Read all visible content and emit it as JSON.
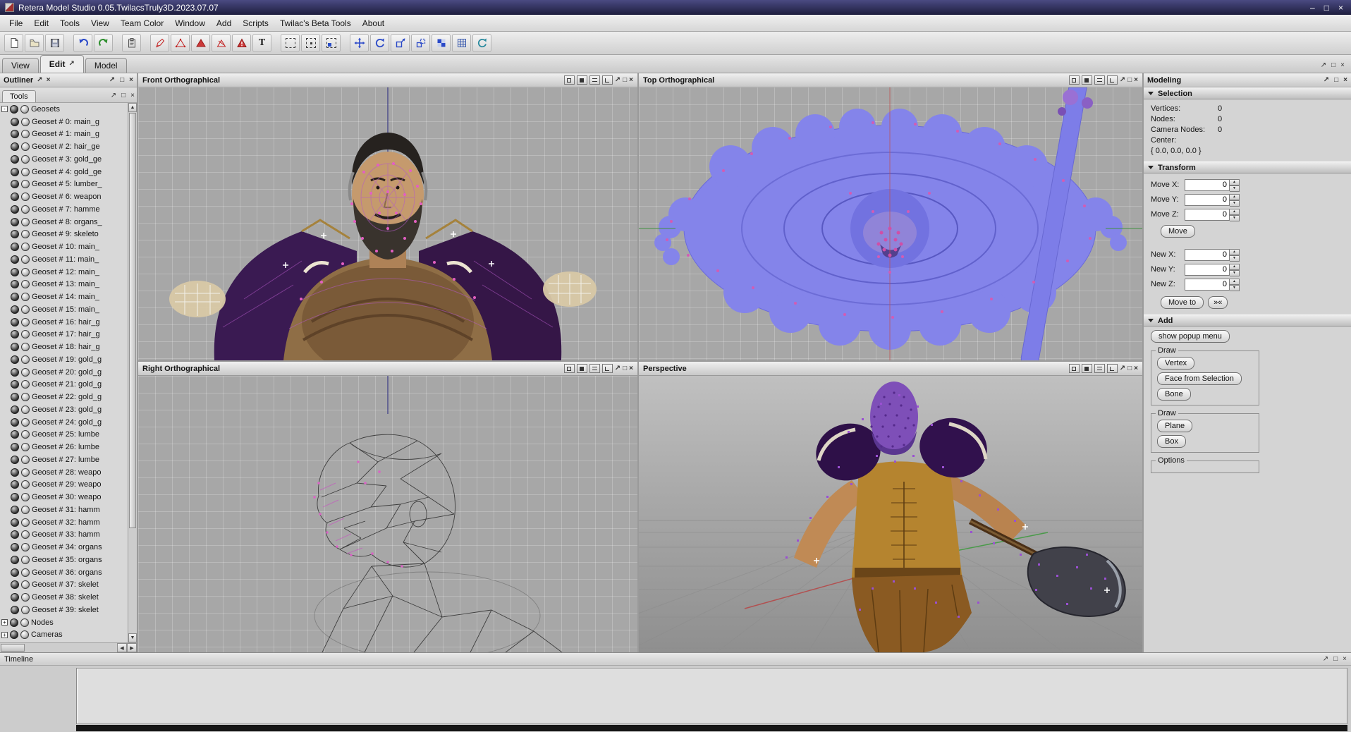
{
  "window": {
    "title": "Retera Model Studio 0.05.TwilacsTruly3D.2023.07.07",
    "minimize": "–",
    "maximize": "□",
    "close": "×"
  },
  "chrome": {
    "float": "↗",
    "maximize": "□",
    "close": "×",
    "spin_up": "▲",
    "spin_down": "▼",
    "arrow_up": "▲",
    "arrow_down": "▼",
    "arrow_left": "◀",
    "arrow_right": "▶"
  },
  "menubar": {
    "items": [
      "File",
      "Edit",
      "Tools",
      "View",
      "Team Color",
      "Window",
      "Add",
      "Scripts",
      "Twilac's Beta Tools",
      "About"
    ]
  },
  "toolbar": {
    "text_glyph": "T",
    "icons": [
      "new-document",
      "open-model",
      "save",
      "undo",
      "redo",
      "paste",
      "edit-pen",
      "face-outline",
      "face-solid",
      "rig-pen",
      "face-alert",
      "text-tool",
      "select-marquee",
      "select-add",
      "select-paint",
      "move-tool",
      "rotate-tool",
      "scale-tool",
      "extrude-tool",
      "snap-checker",
      "snap-grid",
      "recalculate-normals"
    ]
  },
  "tabs": {
    "items": [
      {
        "label": "View"
      },
      {
        "label": "Edit"
      },
      {
        "label": "Model"
      }
    ],
    "active": "Edit"
  },
  "outliner": {
    "title": "Outliner",
    "tools_tab": "Tools",
    "items": [
      {
        "label": "Geosets",
        "exp": "-",
        "cls": "root"
      },
      {
        "label": "Geoset # 0: main_g",
        "exp": "",
        "cls": "child"
      },
      {
        "label": "Geoset # 1: main_g",
        "exp": "",
        "cls": "child"
      },
      {
        "label": "Geoset # 2: hair_ge",
        "exp": "",
        "cls": "child"
      },
      {
        "label": "Geoset # 3: gold_ge",
        "exp": "",
        "cls": "child"
      },
      {
        "label": "Geoset # 4: gold_ge",
        "exp": "",
        "cls": "child"
      },
      {
        "label": "Geoset # 5: lumber_",
        "exp": "",
        "cls": "child"
      },
      {
        "label": "Geoset # 6: weapon",
        "exp": "",
        "cls": "child"
      },
      {
        "label": "Geoset # 7: hamme",
        "exp": "",
        "cls": "child"
      },
      {
        "label": "Geoset # 8: organs_",
        "exp": "",
        "cls": "child"
      },
      {
        "label": "Geoset # 9: skeleto",
        "exp": "",
        "cls": "child"
      },
      {
        "label": "Geoset # 10: main_",
        "exp": "",
        "cls": "child"
      },
      {
        "label": "Geoset # 11: main_",
        "exp": "",
        "cls": "child"
      },
      {
        "label": "Geoset # 12: main_",
        "exp": "",
        "cls": "child"
      },
      {
        "label": "Geoset # 13: main_",
        "exp": "",
        "cls": "child"
      },
      {
        "label": "Geoset # 14: main_",
        "exp": "",
        "cls": "child"
      },
      {
        "label": "Geoset # 15: main_",
        "exp": "",
        "cls": "child"
      },
      {
        "label": "Geoset # 16: hair_g",
        "exp": "",
        "cls": "child"
      },
      {
        "label": "Geoset # 17: hair_g",
        "exp": "",
        "cls": "child"
      },
      {
        "label": "Geoset # 18: hair_g",
        "exp": "",
        "cls": "child"
      },
      {
        "label": "Geoset # 19: gold_g",
        "exp": "",
        "cls": "child"
      },
      {
        "label": "Geoset # 20: gold_g",
        "exp": "",
        "cls": "child"
      },
      {
        "label": "Geoset # 21: gold_g",
        "exp": "",
        "cls": "child"
      },
      {
        "label": "Geoset # 22: gold_g",
        "exp": "",
        "cls": "child"
      },
      {
        "label": "Geoset # 23: gold_g",
        "exp": "",
        "cls": "child"
      },
      {
        "label": "Geoset # 24: gold_g",
        "exp": "",
        "cls": "child"
      },
      {
        "label": "Geoset # 25: lumbe",
        "exp": "",
        "cls": "child"
      },
      {
        "label": "Geoset # 26: lumbe",
        "exp": "",
        "cls": "child"
      },
      {
        "label": "Geoset # 27: lumbe",
        "exp": "",
        "cls": "child"
      },
      {
        "label": "Geoset # 28: weapo",
        "exp": "",
        "cls": "child"
      },
      {
        "label": "Geoset # 29: weapo",
        "exp": "",
        "cls": "child"
      },
      {
        "label": "Geoset # 30: weapo",
        "exp": "",
        "cls": "child"
      },
      {
        "label": "Geoset # 31: hamm",
        "exp": "",
        "cls": "child"
      },
      {
        "label": "Geoset # 32: hamm",
        "exp": "",
        "cls": "child"
      },
      {
        "label": "Geoset # 33: hamm",
        "exp": "",
        "cls": "child"
      },
      {
        "label": "Geoset # 34: organs",
        "exp": "",
        "cls": "child"
      },
      {
        "label": "Geoset # 35: organs",
        "exp": "",
        "cls": "child"
      },
      {
        "label": "Geoset # 36: organs",
        "exp": "",
        "cls": "child"
      },
      {
        "label": "Geoset # 37: skelet",
        "exp": "",
        "cls": "child"
      },
      {
        "label": "Geoset # 38: skelet",
        "exp": "",
        "cls": "child"
      },
      {
        "label": "Geoset # 39: skelet",
        "exp": "",
        "cls": "child"
      },
      {
        "label": "Nodes",
        "exp": "+",
        "cls": "root"
      },
      {
        "label": "Cameras",
        "exp": "+",
        "cls": "root"
      }
    ]
  },
  "viewports": {
    "front": {
      "title": "Front Orthographical"
    },
    "top": {
      "title": "Top Orthographical"
    },
    "right": {
      "title": "Right Orthographical"
    },
    "perspective": {
      "title": "Perspective"
    }
  },
  "modeling": {
    "title": "Modeling",
    "selection": {
      "header": "Selection",
      "vertices_label": "Vertices:",
      "vertices": "0",
      "nodes_label": "Nodes:",
      "nodes": "0",
      "camera_nodes_label": "Camera Nodes:",
      "camera_nodes": "0",
      "center_label": "Center:",
      "center": "{ 0.0, 0.0, 0.0 }"
    },
    "transform": {
      "header": "Transform",
      "move_x": "Move X:",
      "move_y": "Move Y:",
      "move_z": "Move Z:",
      "move_button": "Move",
      "new_x": "New X:",
      "new_y": "New Y:",
      "new_z": "New Z:",
      "move_to_button": "Move to",
      "swap_button": "»«"
    },
    "values": {
      "move_x": "0",
      "move_y": "0",
      "move_z": "0",
      "new_x": "0",
      "new_y": "0",
      "new_z": "0"
    },
    "add": {
      "header": "Add",
      "popup_button": "show popup menu",
      "draw1_label": "Draw",
      "vertex_button": "Vertex",
      "face_button": "Face from Selection",
      "bone_button": "Bone",
      "draw2_label": "Draw",
      "plane_button": "Plane",
      "box_button": "Box",
      "options_label": "Options"
    }
  },
  "timeline": {
    "title": "Timeline"
  }
}
